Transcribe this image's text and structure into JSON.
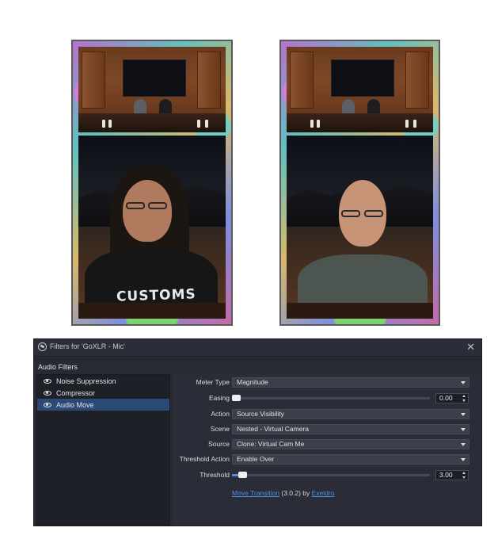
{
  "previews": {
    "left_shirt_text": "CUSTOMS"
  },
  "dialog": {
    "title": "Filters for 'GoXLR - Mic'",
    "section_label": "Audio Filters",
    "filters": [
      {
        "label": "Noise Suppression",
        "selected": false
      },
      {
        "label": "Compressor",
        "selected": false
      },
      {
        "label": "Audio Move",
        "selected": true
      }
    ],
    "properties": {
      "meter_type": {
        "label": "Meter Type",
        "value": "Magnitude"
      },
      "easing": {
        "label": "Easing",
        "value": "0.00",
        "level": 0.0
      },
      "action": {
        "label": "Action",
        "value": "Source Visibility"
      },
      "scene": {
        "label": "Scene",
        "value": "Nested - Virtual Camera"
      },
      "source": {
        "label": "Source",
        "value": "Clone: Virtual Cam Me"
      },
      "threshold_action": {
        "label": "Threshold Action",
        "value": "Enable Over"
      },
      "threshold": {
        "label": "Threshold",
        "value": "3.00",
        "level": 0.03
      }
    },
    "footer": {
      "link": "Move Transition",
      "version": " (3.0.2) by ",
      "author": "Exeldro"
    }
  },
  "colors": {
    "dialog_bg": "#272a33",
    "selected_bg": "#2b4a77",
    "link": "#4f8fe3"
  }
}
